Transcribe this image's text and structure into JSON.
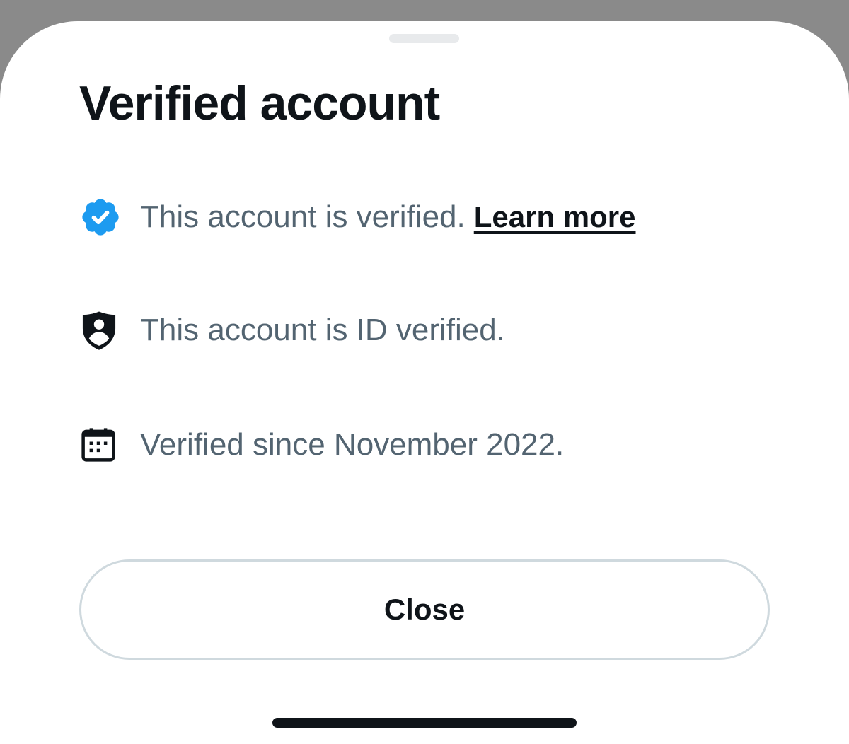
{
  "sheet": {
    "title": "Verified account"
  },
  "items": [
    {
      "icon": "verified-badge-icon",
      "text": "This account is verified.",
      "link": "Learn more",
      "icon_color": "#1d9bf0"
    },
    {
      "icon": "id-shield-icon",
      "text": "This account is ID verified."
    },
    {
      "icon": "calendar-icon",
      "text": "Verified since November 2022."
    }
  ],
  "close_button": {
    "label": "Close"
  },
  "colors": {
    "backdrop": "#8a8a8a",
    "sheet": "#ffffff",
    "primary_text": "#0f1419",
    "secondary_text": "#536471",
    "verified_blue": "#1d9bf0",
    "button_border": "#cfd9de"
  }
}
